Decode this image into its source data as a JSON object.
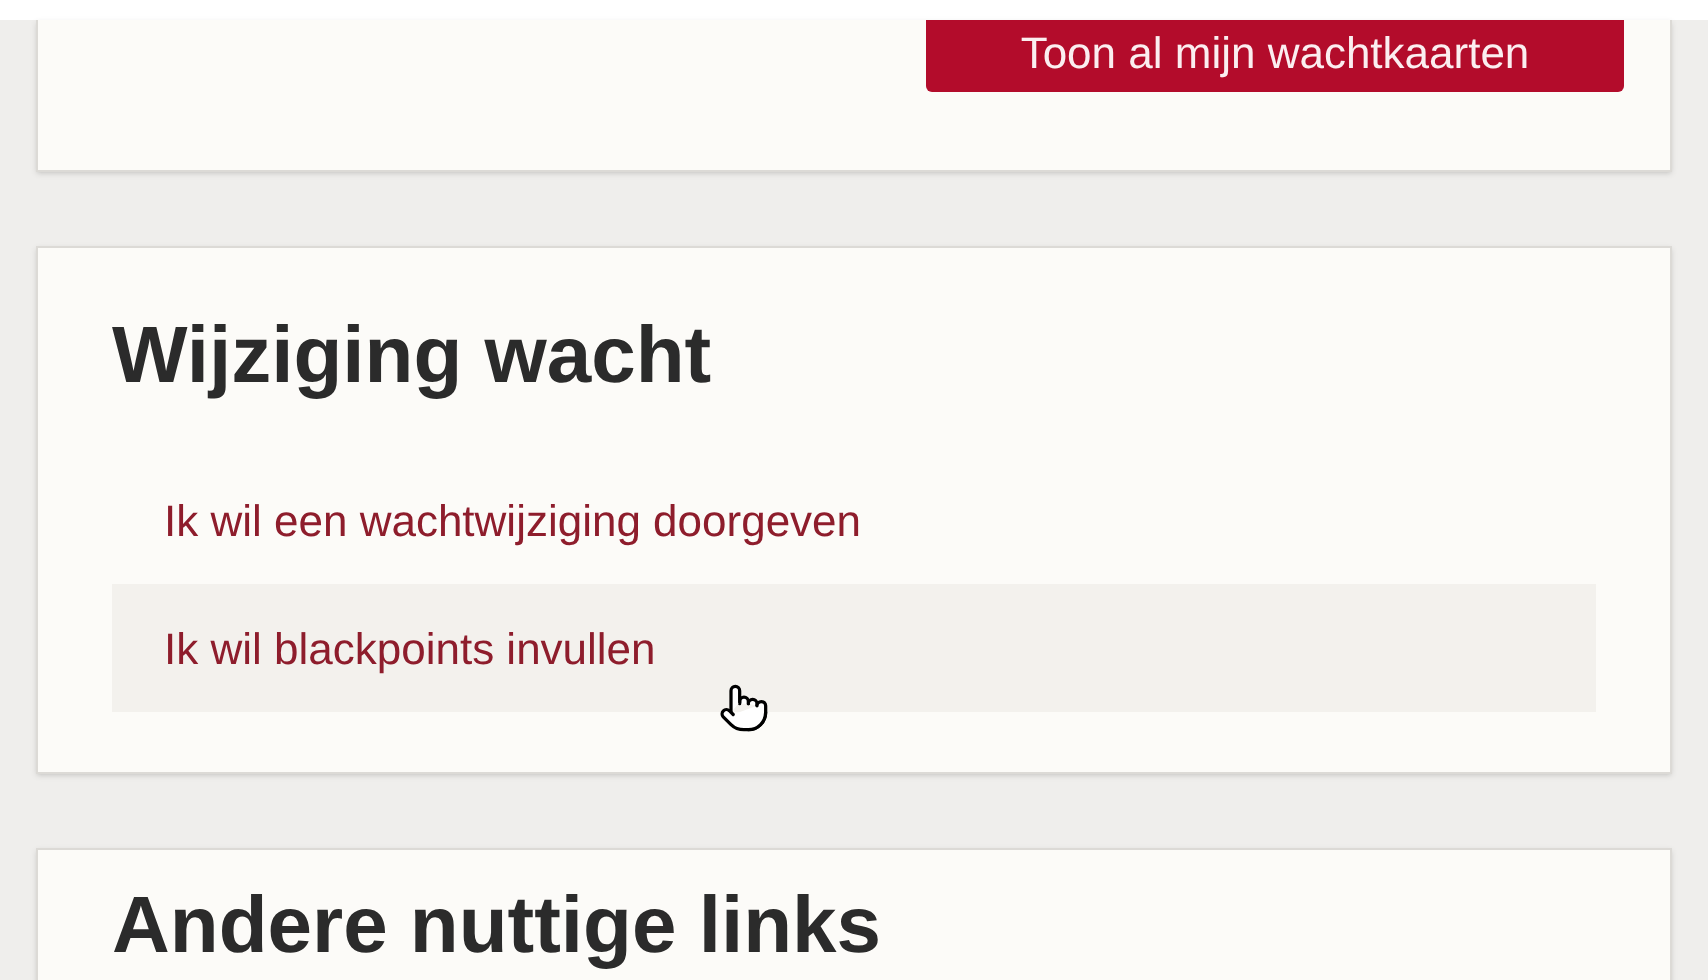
{
  "top_card": {
    "button": "Toon al mijn wachtkaarten"
  },
  "change_card": {
    "title": "Wijziging wacht",
    "links": [
      {
        "label": "Ik wil een wachtwijziging doorgeven",
        "hovered": false
      },
      {
        "label": "Ik wil blackpoints invullen",
        "hovered": true
      }
    ]
  },
  "links_card": {
    "title": "Andere nuttige links"
  }
}
